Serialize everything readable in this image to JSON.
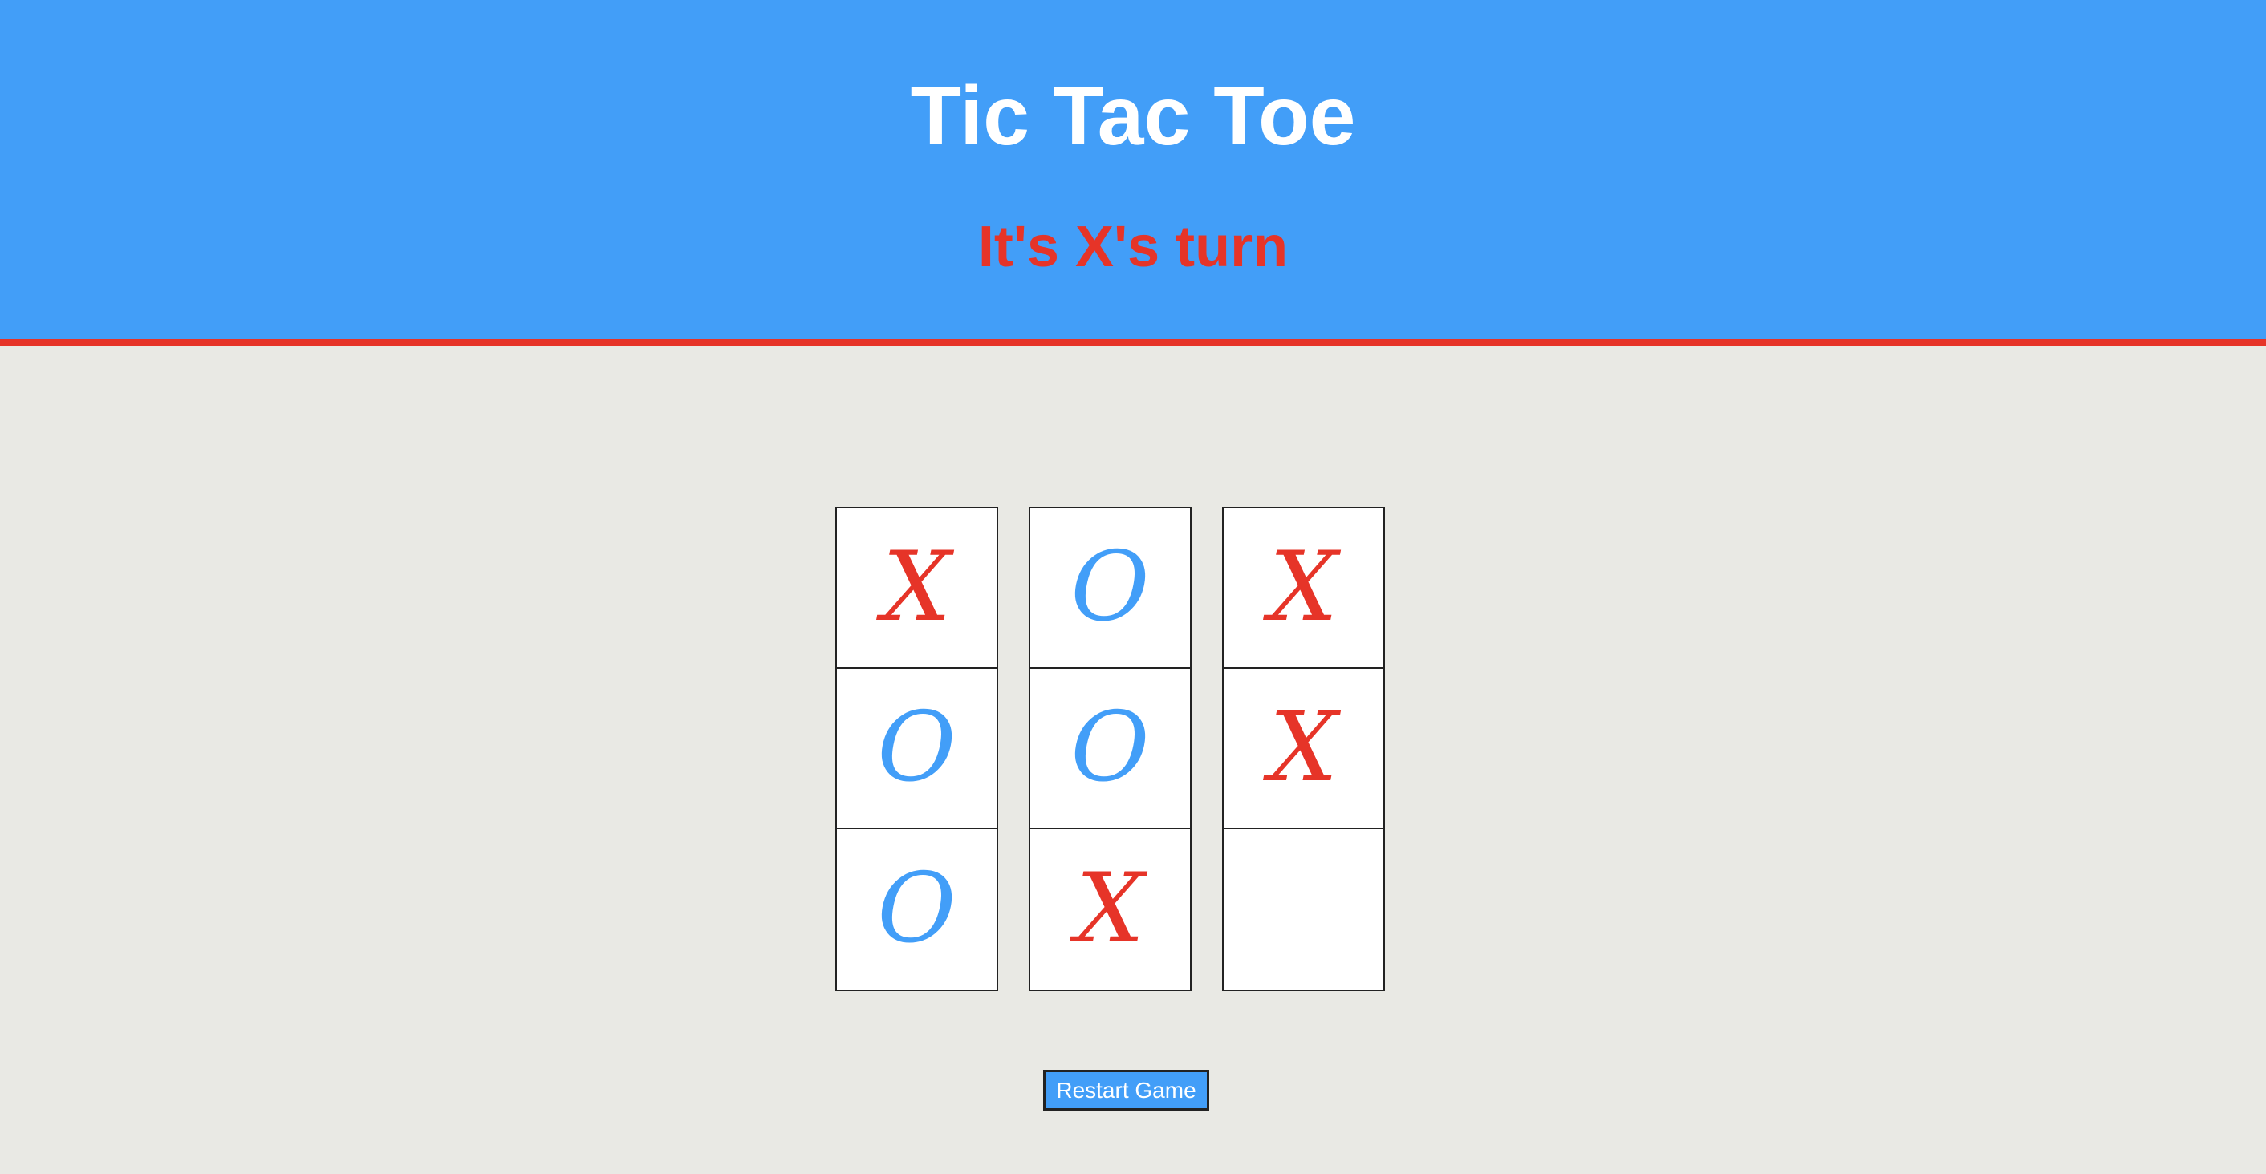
{
  "header": {
    "title": "Tic Tac Toe",
    "status": "It's X's turn"
  },
  "board": {
    "columns": [
      [
        "X",
        "O",
        "O"
      ],
      [
        "O",
        "O",
        "X"
      ],
      [
        "X",
        "X",
        ""
      ]
    ]
  },
  "controls": {
    "restart_label": "Restart Game"
  },
  "colors": {
    "x": "#e63428",
    "o": "#429ef8",
    "header_bg": "#429ef8",
    "accent": "#e63428",
    "page_bg": "#e9e9e4"
  }
}
